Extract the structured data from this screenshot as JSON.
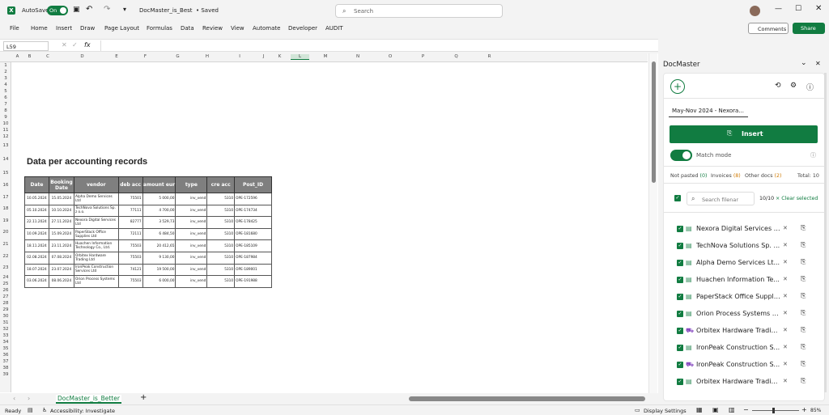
{
  "titlebar": {
    "autosave_label": "AutoSave",
    "autosave_state": "On",
    "doc_title": "DocMaster_is_Best",
    "saved_status": "• Saved",
    "search_placeholder": "Search"
  },
  "menu": [
    "File",
    "Home",
    "Insert",
    "Draw",
    "Page Layout",
    "Formulas",
    "Data",
    "Review",
    "View",
    "Automate",
    "Developer",
    "AUDIT"
  ],
  "menu_right": {
    "comments": "Comments",
    "share": "Share"
  },
  "formula_bar": {
    "name_box": "L59",
    "fx": "fx",
    "value": ""
  },
  "columns": [
    "A",
    "B",
    "C",
    "D",
    "E",
    "F",
    "G",
    "H",
    "I",
    "J",
    "K",
    "L",
    "M",
    "N",
    "O",
    "P",
    "Q",
    "R"
  ],
  "rows": [
    "1",
    "2",
    "3",
    "4",
    "5",
    "6",
    "7",
    "8",
    "9",
    "10",
    "11",
    "12",
    "13",
    "14",
    "15",
    "16",
    "17",
    "18",
    "19",
    "20",
    "21",
    "22",
    "23",
    "24",
    "25",
    "26",
    "27",
    "28",
    "29",
    "30",
    "31",
    "32",
    "33",
    "34",
    "35",
    "36",
    "37",
    "38",
    "39"
  ],
  "sheet": {
    "heading": "Data per accounting records",
    "headers": [
      "Date",
      "Booking Date",
      "vendor",
      "deb acc",
      "amount eur",
      "type",
      "cre acc",
      "Post_ID"
    ],
    "rows": [
      [
        "10.05.2024",
        "15.05.2024",
        "Alpha Demo Services Ltd",
        "75501",
        "5 000,00",
        "inv_vend",
        "5310",
        "OPE-172596"
      ],
      [
        "05.10.2024",
        "10.10.2024",
        "TechNova Solutions Sp. z o.o.",
        "77111",
        "4 700,00",
        "inv_vend",
        "5310",
        "OPE-174734"
      ],
      [
        "22.11.2024",
        "27.11.2024",
        "Nexora Digital Services Ltd",
        "82777",
        "3 529,73",
        "inv_vend",
        "5310",
        "OPE-178425"
      ],
      [
        "10.09.2024",
        "15.09.2024",
        "PaperStack Office Supplies Ltd",
        "72111",
        "6 484,50",
        "inv_vend",
        "5310",
        "OPE-181680"
      ],
      [
        "18.11.2024",
        "23.11.2024",
        "Huachen Information Technology Co., Ltd.",
        "75503",
        "20 412,65",
        "inv_vend",
        "5310",
        "OPE-185109"
      ],
      [
        "02.08.2024",
        "07.08.2024",
        "Orbitex Hardware Trading Ltd",
        "75503",
        "9 130,00",
        "inv_vend",
        "5310",
        "OPE-187984"
      ],
      [
        "18.07.2024",
        "23.07.2024",
        "IronPeak Construction Services Ltd",
        "74121",
        "19 500,00",
        "inv_vend",
        "5310",
        "OPE-189001"
      ],
      [
        "03.06.2024",
        "08.06.2024",
        "Orion Process Systems Ltd",
        "75503",
        "6 000,00",
        "inv_vend",
        "5310",
        "OPE-191988"
      ]
    ]
  },
  "tabs": {
    "active": "DocMaster_is_Better",
    "add": "+"
  },
  "status": {
    "ready": "Ready",
    "accessibility": "Accessibility: Investigate",
    "display_settings": "Display Settings",
    "zoom": "85%"
  },
  "panel": {
    "title": "DocMaster",
    "dropdown_value": "May-Nov 2024 - Nexora...",
    "insert_label": "Insert",
    "match_mode_label": "Match mode",
    "filters": {
      "not_pasted_label": "Not pasted",
      "not_pasted_count": "(0)",
      "invoices_label": "Invoices",
      "invoices_count": "(8)",
      "other_label": "Other docs",
      "other_count": "(2)",
      "total": "Total: 10"
    },
    "search_placeholder": "Search filenar",
    "selected_count": "10/10",
    "clear_label": "× Clear selected",
    "items": [
      {
        "name": "Nexora Digital Services L...",
        "doc_type": "invoice"
      },
      {
        "name": "TechNova Solutions Sp. ...",
        "doc_type": "invoice"
      },
      {
        "name": "Alpha Demo Services Lt...",
        "doc_type": "invoice"
      },
      {
        "name": "Huachen Information Te...",
        "doc_type": "invoice"
      },
      {
        "name": "PaperStack Office Suppli...",
        "doc_type": "invoice"
      },
      {
        "name": "Orion Process Systems L...",
        "doc_type": "invoice"
      },
      {
        "name": "Orbitex Hardware Tradin...",
        "doc_type": "delivery"
      },
      {
        "name": "IronPeak Construction S...",
        "doc_type": "invoice"
      },
      {
        "name": "IronPeak Construction S...",
        "doc_type": "delivery"
      },
      {
        "name": "Orbitex Hardware Tradin...",
        "doc_type": "invoice"
      }
    ]
  },
  "colors": {
    "accent": "#117c41",
    "invoice_icon": "#2e8b57",
    "delivery_icon": "#8a4fc2",
    "header_gray": "#7f7f7f"
  }
}
